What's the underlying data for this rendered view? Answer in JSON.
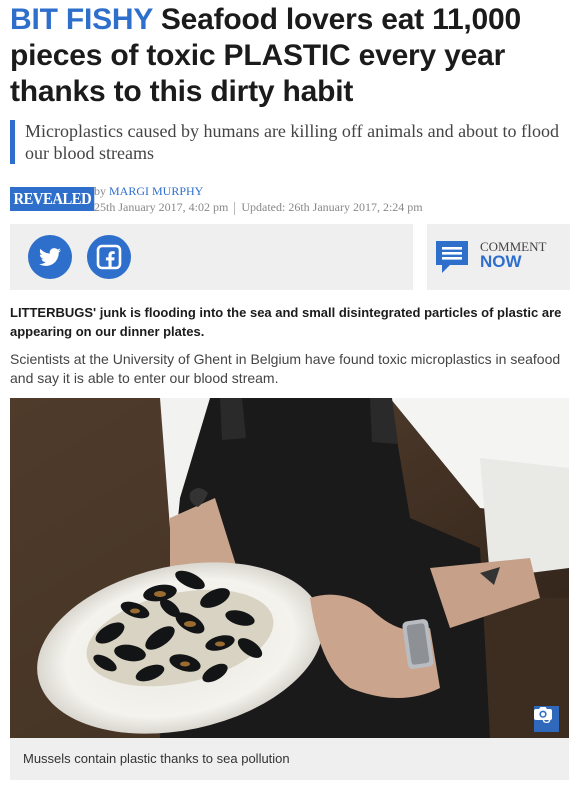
{
  "article": {
    "kicker": "BIT FISHY",
    "headline": "Seafood lovers eat 11,000 pieces of toxic PLASTIC every year thanks to this dirty habit",
    "standfirst": "Microplastics caused by humans are killing off animals and about to flood our blood streams",
    "badge": "REVEALED",
    "byline_prefix": "by",
    "author": "MARGI MURPHY",
    "published": "25th January 2017, 4:02 pm",
    "updated": "Updated: 26th January 2017, 2:24 pm",
    "lead": "LITTERBUGS' junk is flooding into the sea and small disintegrated particles of plastic are appearing on our dinner plates.",
    "paragraph": "Scientists at the University of Ghent in Belgium have found toxic microplastics in seafood and say it is able to enter our blood stream.",
    "photo_count": "3",
    "caption": "Mussels contain plastic thanks to sea pollution"
  },
  "share": {
    "twitter_icon": "twitter-bird-icon",
    "facebook_icon": "facebook-f-icon",
    "comment_line1": "COMMENT",
    "comment_line2": "NOW"
  },
  "colors": {
    "accent": "#2f6fcc",
    "text": "#1b1b1b",
    "muted": "#888888",
    "panel": "#efefef"
  }
}
